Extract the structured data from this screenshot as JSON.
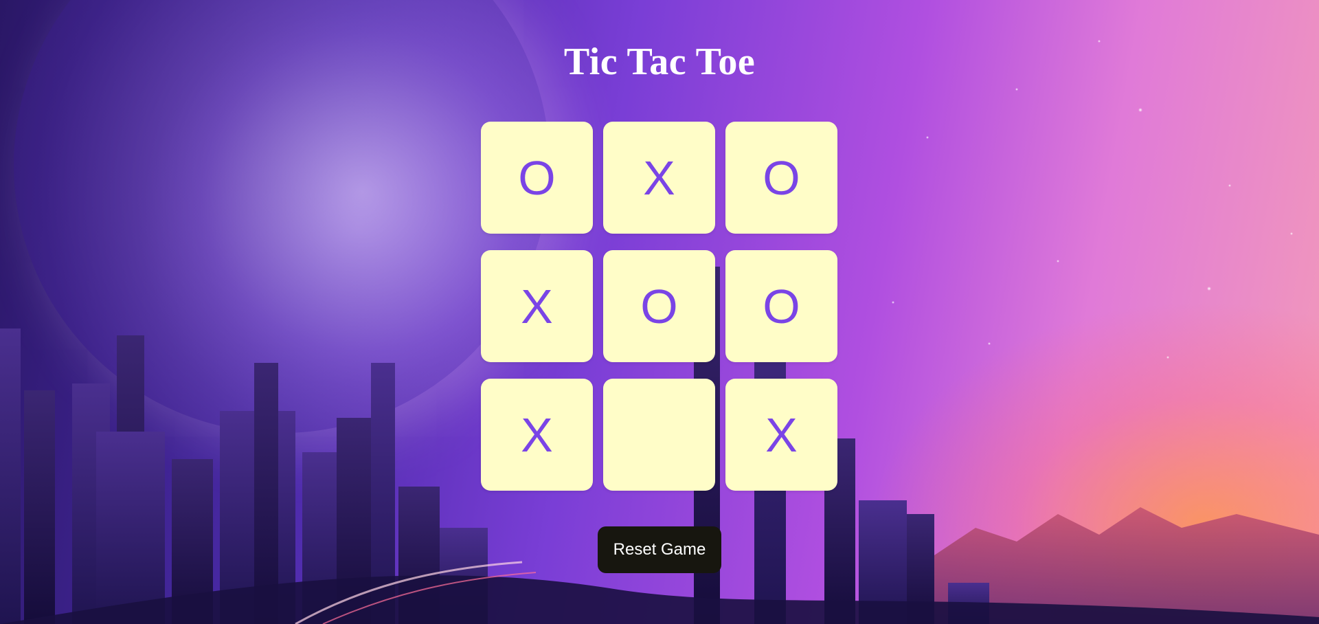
{
  "title": "Tic Tac Toe",
  "board": {
    "cells": [
      "O",
      "X",
      "O",
      "X",
      "O",
      "O",
      "X",
      "",
      "X"
    ]
  },
  "reset_label": "Reset Game",
  "colors": {
    "cell_background": "#fffdc8",
    "mark_color": "#7a44e6",
    "button_background": "#17160f",
    "title_color": "#ffffff"
  }
}
